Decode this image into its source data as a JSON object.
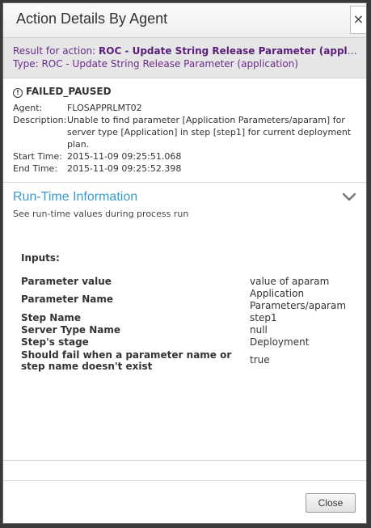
{
  "dialog": {
    "title": "Action Details By Agent",
    "close_glyph": "×"
  },
  "result": {
    "prefix": "Result for action:",
    "action_name": "ROC - Update String Release Parameter (application)",
    "type_prefix": "Type:",
    "type_value": "ROC - Update String Release Parameter (application)"
  },
  "status": {
    "icon": "warning-circle-icon",
    "text": "FAILED_PAUSED"
  },
  "details": [
    {
      "label": "Agent:",
      "value": "FLOSAPPRLMT02"
    },
    {
      "label": "Description:",
      "value": "Unable to find parameter [Application Parameters/aparam] for server type [Application] in step [step1] for current deployment plan."
    },
    {
      "label": "Start Time:",
      "value": "2015-11-09 09:25:51.068"
    },
    {
      "label": "End Time:",
      "value": "2015-11-09 09:25:52.398"
    }
  ],
  "runtime": {
    "title": "Run-Time Information",
    "subtitle": "See run-time values during process run",
    "chevron_icon": "chevron-down-icon",
    "inputs_heading": "Inputs:",
    "params": [
      {
        "name": "Parameter value",
        "value": "value of aparam"
      },
      {
        "name": "Parameter Name",
        "value": "Application Parameters/aparam"
      },
      {
        "name": "Step Name",
        "value": "step1"
      },
      {
        "name": "Server Type Name",
        "value": "null"
      },
      {
        "name": "Step's stage",
        "value": "Deployment"
      },
      {
        "name": "Should fail when a parameter name or step name doesn't exist",
        "value": "true"
      }
    ]
  },
  "footer": {
    "close_label": "Close"
  },
  "colors": {
    "accent": "#3a9ac9",
    "result_text": "#6b2c8a"
  }
}
